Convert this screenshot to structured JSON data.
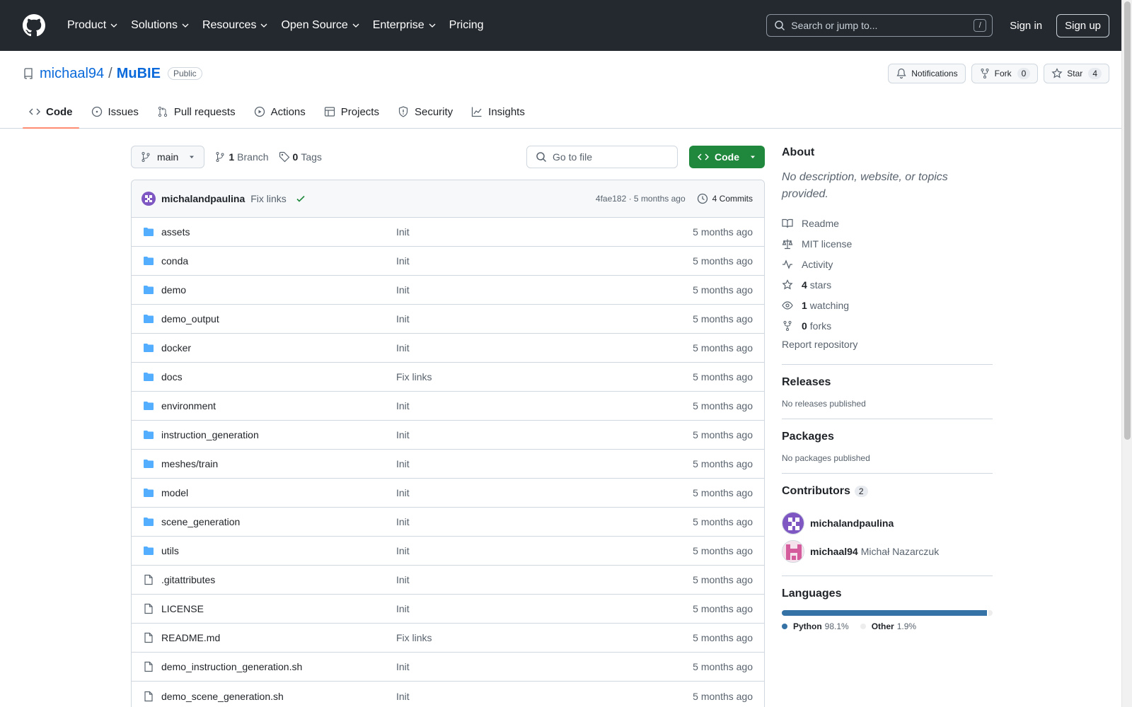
{
  "header": {
    "nav": [
      "Product",
      "Solutions",
      "Resources",
      "Open Source",
      "Enterprise",
      "Pricing"
    ],
    "search_placeholder": "Search or jump to...",
    "search_shortcut": "/",
    "signin": "Sign in",
    "signup": "Sign up"
  },
  "repo": {
    "owner": "michaal94",
    "separator": "/",
    "name": "MuBIE",
    "visibility": "Public",
    "notifications_label": "Notifications",
    "fork_label": "Fork",
    "fork_count": "0",
    "star_label": "Star",
    "star_count": "4"
  },
  "tabs": [
    "Code",
    "Issues",
    "Pull requests",
    "Actions",
    "Projects",
    "Security",
    "Insights"
  ],
  "toolbar": {
    "branch": "main",
    "branch_count": "1",
    "branch_label": "Branch",
    "tag_count": "0",
    "tag_label": "Tags",
    "goto_placeholder": "Go to file",
    "code_button": "Code"
  },
  "latest_commit": {
    "author": "michalandpaulina",
    "message": "Fix links",
    "hash_time": "4fae182 · 5 months ago",
    "commits": "4 Commits"
  },
  "files": [
    {
      "name": "assets",
      "type": "dir",
      "message": "Init",
      "time": "5 months ago"
    },
    {
      "name": "conda",
      "type": "dir",
      "message": "Init",
      "time": "5 months ago"
    },
    {
      "name": "demo",
      "type": "dir",
      "message": "Init",
      "time": "5 months ago"
    },
    {
      "name": "demo_output",
      "type": "dir",
      "message": "Init",
      "time": "5 months ago"
    },
    {
      "name": "docker",
      "type": "dir",
      "message": "Init",
      "time": "5 months ago"
    },
    {
      "name": "docs",
      "type": "dir",
      "message": "Fix links",
      "time": "5 months ago"
    },
    {
      "name": "environment",
      "type": "dir",
      "message": "Init",
      "time": "5 months ago"
    },
    {
      "name": "instruction_generation",
      "type": "dir",
      "message": "Init",
      "time": "5 months ago"
    },
    {
      "name": "meshes/train",
      "type": "dir",
      "message": "Init",
      "time": "5 months ago"
    },
    {
      "name": "model",
      "type": "dir",
      "message": "Init",
      "time": "5 months ago"
    },
    {
      "name": "scene_generation",
      "type": "dir",
      "message": "Init",
      "time": "5 months ago"
    },
    {
      "name": "utils",
      "type": "dir",
      "message": "Init",
      "time": "5 months ago"
    },
    {
      "name": ".gitattributes",
      "type": "file",
      "message": "Init",
      "time": "5 months ago"
    },
    {
      "name": "LICENSE",
      "type": "file",
      "message": "Init",
      "time": "5 months ago"
    },
    {
      "name": "README.md",
      "type": "file",
      "message": "Fix links",
      "time": "5 months ago"
    },
    {
      "name": "demo_instruction_generation.sh",
      "type": "file",
      "message": "Init",
      "time": "5 months ago"
    },
    {
      "name": "demo_scene_generation.sh",
      "type": "file",
      "message": "Init",
      "time": "5 months ago"
    }
  ],
  "about": {
    "title": "About",
    "description": "No description, website, or topics provided.",
    "readme": "Readme",
    "license": "MIT license",
    "activity": "Activity",
    "stars_count": "4",
    "stars_label": "stars",
    "watching_count": "1",
    "watching_label": "watching",
    "forks_count": "0",
    "forks_label": "forks",
    "report": "Report repository"
  },
  "releases": {
    "title": "Releases",
    "text": "No releases published"
  },
  "packages": {
    "title": "Packages",
    "text": "No packages published"
  },
  "contributors": {
    "title": "Contributors",
    "count": "2",
    "list": [
      {
        "login": "michalandpaulina",
        "name": ""
      },
      {
        "login": "michaal94",
        "name": "Michał Nazarczuk"
      }
    ]
  },
  "languages": {
    "title": "Languages",
    "items": [
      {
        "name": "Python",
        "percent": "98.1%",
        "value": 98.1,
        "color": "#3572A5"
      },
      {
        "name": "Other",
        "percent": "1.9%",
        "value": 1.9,
        "color": "#ededed"
      }
    ]
  },
  "colors": {
    "link": "#0969da",
    "primary_button": "#1f883d",
    "header_bg": "#24292f"
  }
}
